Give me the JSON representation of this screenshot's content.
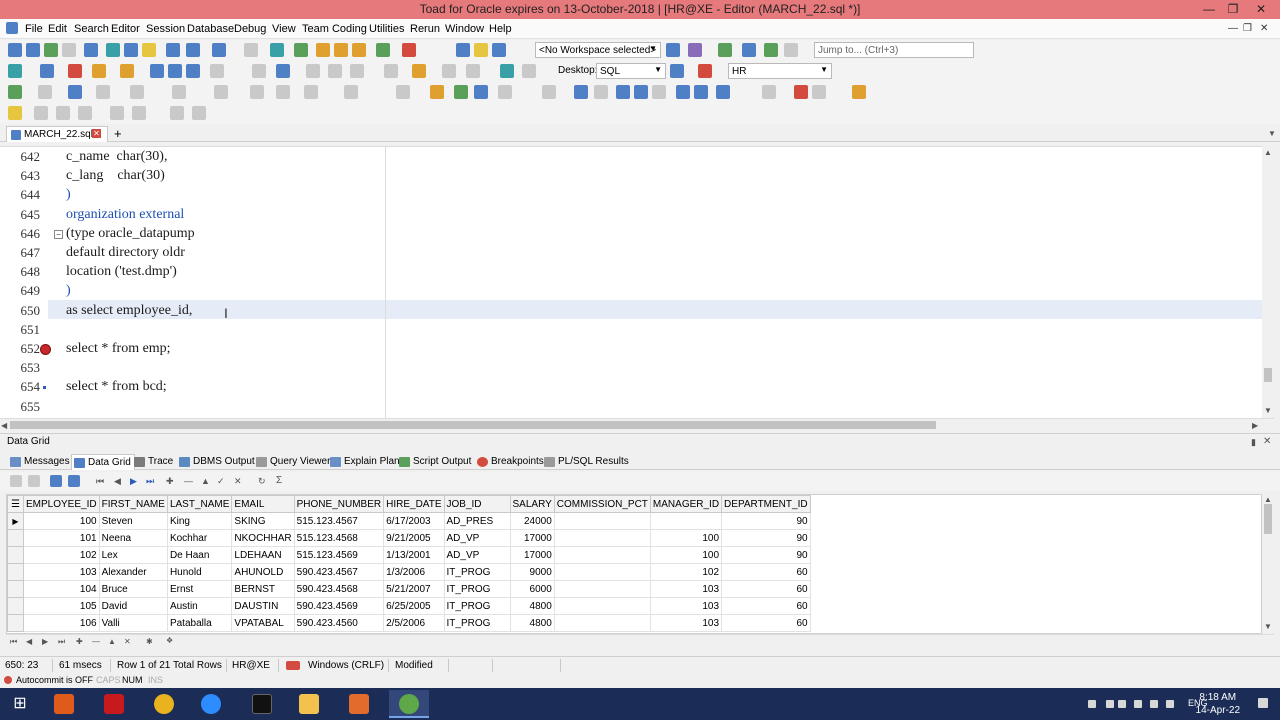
{
  "window": {
    "title": "Toad for Oracle expires on 13-October-2018  |  [HR@XE - Editor (MARCH_22.sql *)]"
  },
  "menu": [
    "File",
    "Edit",
    "Search",
    "Editor",
    "Session",
    "Database",
    "Debug",
    "View",
    "Team Coding",
    "Utilities",
    "Rerun",
    "Window",
    "Help"
  ],
  "toolbar": {
    "workspace": "<No Workspace selected>",
    "jump_placeholder": "Jump to... (Ctrl+3)",
    "desktop_label": "Desktop:",
    "desktop_value": "SQL",
    "connection": "HR"
  },
  "tabs": {
    "active": "MARCH_22.sql",
    "add": "+"
  },
  "editor": {
    "lines": [
      {
        "n": "642",
        "text": "c_name  char(30),"
      },
      {
        "n": "643",
        "text": "c_lang    char(30)"
      },
      {
        "n": "644",
        "text": ")"
      },
      {
        "n": "645",
        "text": "organization external"
      },
      {
        "n": "646",
        "text": "(type oracle_datapump"
      },
      {
        "n": "647",
        "text": "default directory oldr"
      },
      {
        "n": "648",
        "text": "location ('test.dmp')"
      },
      {
        "n": "649",
        "text": ")"
      },
      {
        "n": "650",
        "text": "as select employee_id,"
      },
      {
        "n": "651",
        "text": ""
      },
      {
        "n": "652",
        "text": "select * from emp;"
      },
      {
        "n": "653",
        "text": ""
      },
      {
        "n": "654",
        "text": "select * from bcd;"
      },
      {
        "n": "655",
        "text": ""
      }
    ]
  },
  "datagrid": {
    "panel_title": "Data Grid",
    "tabs": [
      "Messages",
      "Data Grid",
      "Trace",
      "DBMS Output",
      "Query Viewer",
      "Explain Plan",
      "Script Output",
      "Breakpoints",
      "PL/SQL Results"
    ],
    "columns": [
      "EMPLOYEE_ID",
      "FIRST_NAME",
      "LAST_NAME",
      "EMAIL",
      "PHONE_NUMBER",
      "HIRE_DATE",
      "JOB_ID",
      "SALARY",
      "COMMISSION_PCT",
      "MANAGER_ID",
      "DEPARTMENT_ID"
    ],
    "rows": [
      [
        "100",
        "Steven",
        "King",
        "SKING",
        "515.123.4567",
        "6/17/2003",
        "AD_PRES",
        "24000",
        "",
        "",
        "90"
      ],
      [
        "101",
        "Neena",
        "Kochhar",
        "NKOCHHAR",
        "515.123.4568",
        "9/21/2005",
        "AD_VP",
        "17000",
        "",
        "100",
        "90"
      ],
      [
        "102",
        "Lex",
        "De Haan",
        "LDEHAAN",
        "515.123.4569",
        "1/13/2001",
        "AD_VP",
        "17000",
        "",
        "100",
        "90"
      ],
      [
        "103",
        "Alexander",
        "Hunold",
        "AHUNOLD",
        "590.423.4567",
        "1/3/2006",
        "IT_PROG",
        "9000",
        "",
        "102",
        "60"
      ],
      [
        "104",
        "Bruce",
        "Ernst",
        "BERNST",
        "590.423.4568",
        "5/21/2007",
        "IT_PROG",
        "6000",
        "",
        "103",
        "60"
      ],
      [
        "105",
        "David",
        "Austin",
        "DAUSTIN",
        "590.423.4569",
        "6/25/2005",
        "IT_PROG",
        "4800",
        "",
        "103",
        "60"
      ],
      [
        "106",
        "Valli",
        "Pataballa",
        "VPATABAL",
        "590.423.4560",
        "2/5/2006",
        "IT_PROG",
        "4800",
        "",
        "103",
        "60"
      ]
    ]
  },
  "status": {
    "position": "650: 23",
    "time": "61 msecs",
    "rows": "Row 1 of 21 Total Rows",
    "conn": "HR@XE",
    "eol": "Windows (CRLF)",
    "state": "Modified",
    "autocommit": "Autocommit is OFF",
    "caps": "CAPS",
    "num": "NUM",
    "ins": "INS"
  },
  "taskbar": {
    "lang": "ENG",
    "time": "8:18 AM",
    "date": "14-Apr-22"
  }
}
